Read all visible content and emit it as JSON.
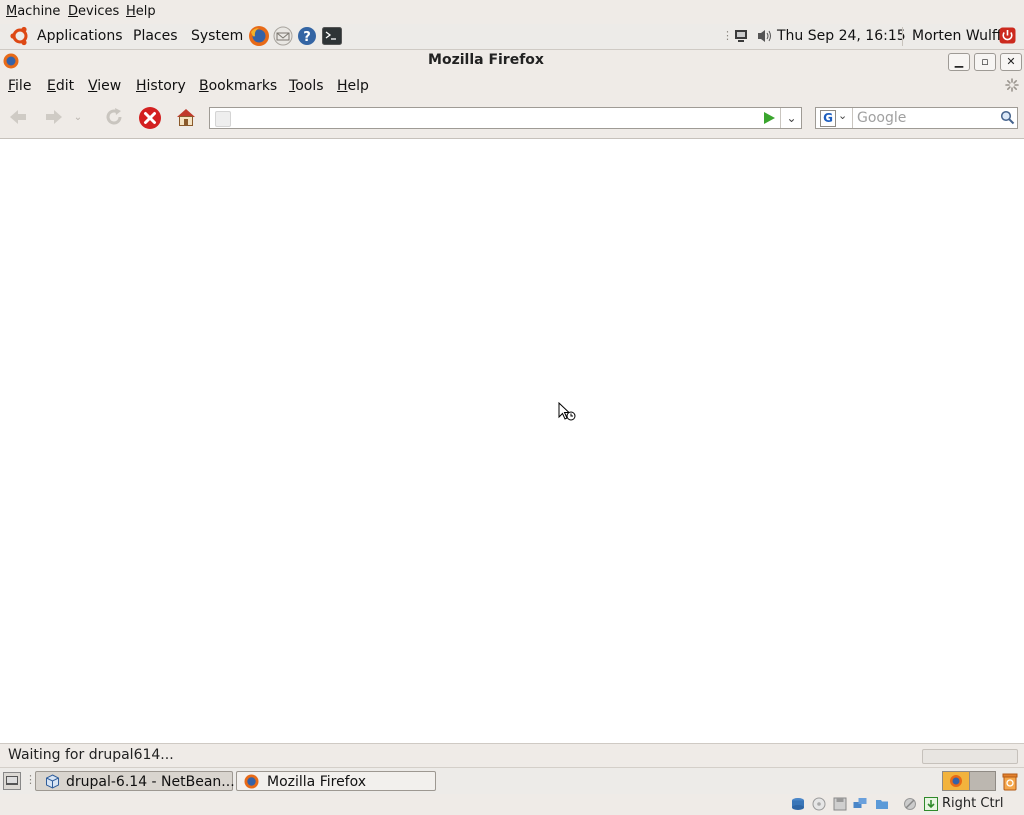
{
  "vbox_menu": {
    "items": [
      "Machine",
      "Devices",
      "Help"
    ]
  },
  "top_panel": {
    "applications": "Applications",
    "places": "Places",
    "system": "System",
    "datetime": "Thu Sep 24, 16:15",
    "user": "Morten Wulff"
  },
  "window": {
    "title": "Mozilla Firefox"
  },
  "menubar": {
    "items": [
      "File",
      "Edit",
      "View",
      "History",
      "Bookmarks",
      "Tools",
      "Help"
    ]
  },
  "navbar": {
    "url_value": "",
    "search_placeholder": "Google"
  },
  "status": {
    "text": "Waiting for drupal614..."
  },
  "taskbar": {
    "tasks": [
      "drupal-6.14 - NetBean...",
      "Mozilla Firefox"
    ]
  },
  "vbox_status": {
    "host_key": "Right Ctrl"
  },
  "colors": {
    "panel_bg": "#edebe8",
    "stop_red": "#d32020",
    "ubuntu_orange": "#dd4814"
  }
}
